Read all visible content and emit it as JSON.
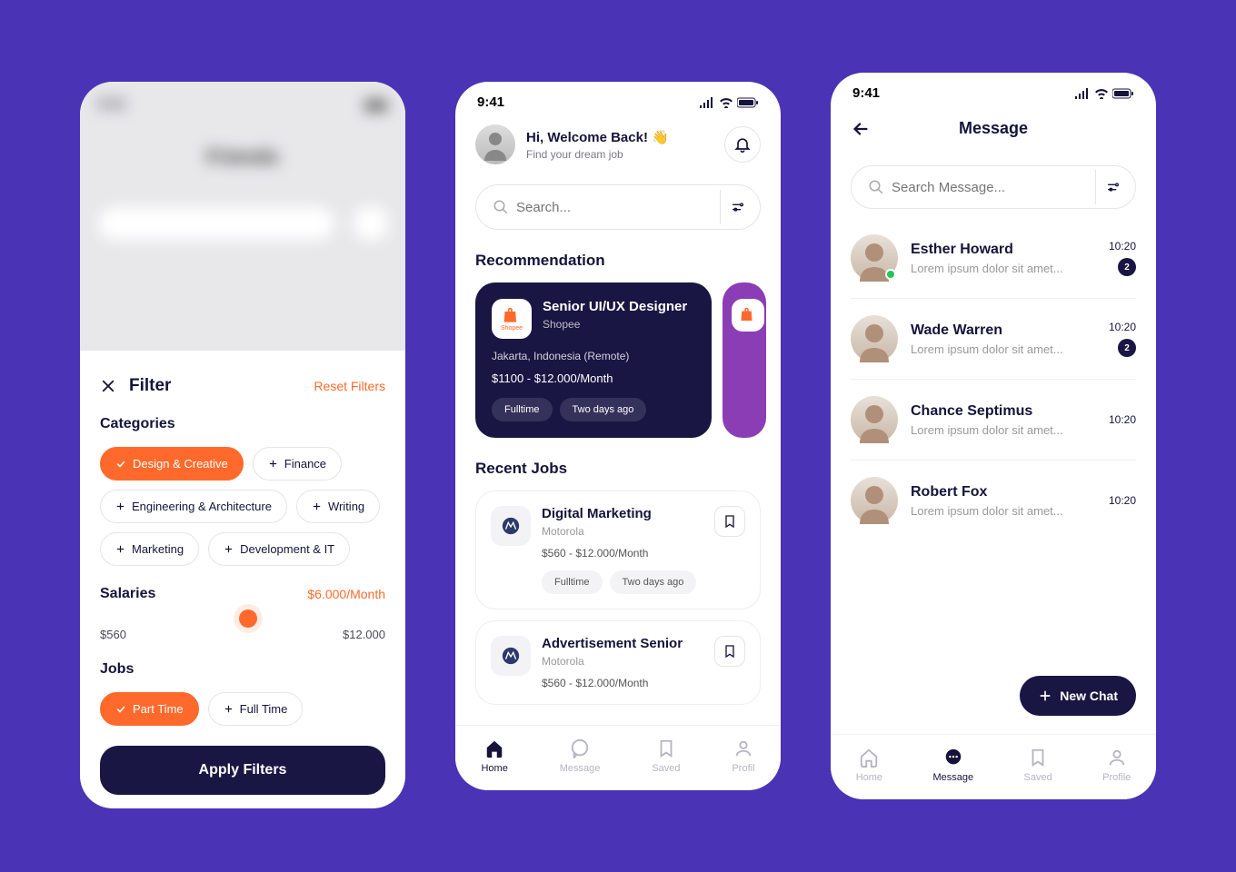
{
  "status_time": "9:41",
  "filter": {
    "title": "Filter",
    "reset": "Reset Filters",
    "categories_label": "Categories",
    "categories": [
      {
        "label": "Design & Creative",
        "active": true
      },
      {
        "label": "Finance",
        "active": false
      },
      {
        "label": "Engineering & Architecture",
        "active": false
      },
      {
        "label": "Writing",
        "active": false
      },
      {
        "label": "Marketing",
        "active": false
      },
      {
        "label": "Development & IT",
        "active": false
      }
    ],
    "salaries_label": "Salaries",
    "salary_current": "$6.000/Month",
    "salary_min": "$560",
    "salary_max": "$12.000",
    "jobs_label": "Jobs",
    "jobs": [
      {
        "label": "Part Time",
        "active": true
      },
      {
        "label": "Full Time",
        "active": false
      }
    ],
    "apply": "Apply Filters"
  },
  "home": {
    "greeting": "Hi, Welcome Back! 👋",
    "subtitle": "Find your dream job",
    "search_placeholder": "Search...",
    "recommendation_label": "Recommendation",
    "rec": {
      "title": "Senior UI/UX Designer",
      "company": "Shopee",
      "logo_label": "Shopee",
      "location": "Jakarta, Indonesia (Remote)",
      "salary": "$1100 - $12.000/Month",
      "tag1": "Fulltime",
      "tag2": "Two days ago"
    },
    "recent_label": "Recent Jobs",
    "jobs": [
      {
        "title": "Digital Marketing",
        "company": "Motorola",
        "salary": "$560 - $12.000/Month",
        "tag1": "Fulltime",
        "tag2": "Two days ago"
      },
      {
        "title": "Advertisement Senior",
        "company": "Motorola",
        "salary": "$560 - $12.000/Month"
      }
    ],
    "nav": {
      "home": "Home",
      "message": "Message",
      "saved": "Saved",
      "profile": "Profil"
    }
  },
  "messages": {
    "title": "Message",
    "search_placeholder": "Search Message...",
    "items": [
      {
        "name": "Esther Howard",
        "preview": "Lorem ipsum dolor sit amet...",
        "time": "10:20",
        "badge": "2",
        "online": true
      },
      {
        "name": "Wade Warren",
        "preview": "Lorem ipsum dolor sit amet...",
        "time": "10:20",
        "badge": "2",
        "online": false
      },
      {
        "name": "Chance Septimus",
        "preview": "Lorem ipsum dolor sit amet...",
        "time": "10:20",
        "badge": null,
        "online": false
      },
      {
        "name": "Robert Fox",
        "preview": "Lorem ipsum dolor sit amet...",
        "time": "10:20",
        "badge": null,
        "online": false
      }
    ],
    "new_chat": "New Chat",
    "nav": {
      "home": "Home",
      "message": "Message",
      "saved": "Saved",
      "profile": "Profile"
    }
  }
}
